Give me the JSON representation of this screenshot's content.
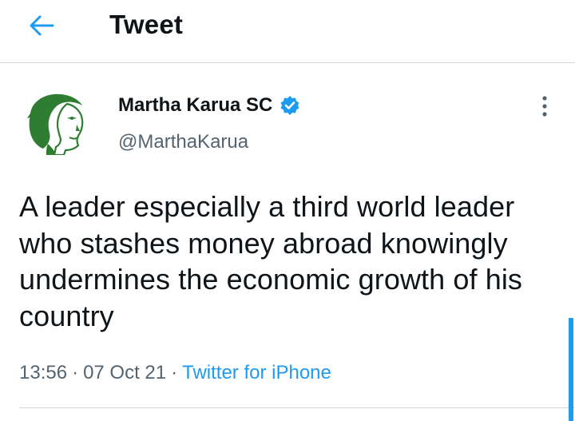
{
  "header": {
    "title": "Tweet",
    "back_icon": "arrow-left-icon"
  },
  "author": {
    "name": "Martha Karua SC",
    "handle": "@MarthaKarua",
    "verified_icon": "verified-badge-icon",
    "avatar_color": "#2e7d32"
  },
  "tweet": {
    "text": "A leader especially a third world leader who stashes money abroad knowingly undermines the economic growth of his country"
  },
  "meta": {
    "time": "13:56",
    "separator": "·",
    "date": "07 Oct 21",
    "source": "Twitter for iPhone"
  },
  "colors": {
    "accent": "#1d9bf0",
    "secondary_text": "#536471",
    "divider": "#cfd9de"
  }
}
